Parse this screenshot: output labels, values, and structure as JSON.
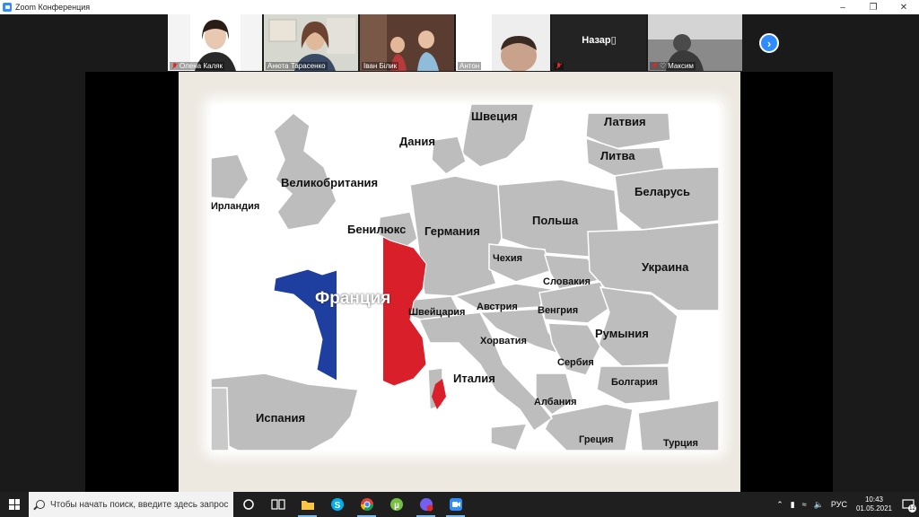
{
  "window": {
    "title": "Zoom Конференция"
  },
  "participants": [
    {
      "name": "Олена Каляк",
      "muted": true
    },
    {
      "name": "Анюта Тарасенко",
      "muted": false
    },
    {
      "name": "Іван Білик",
      "muted": false
    },
    {
      "name": "Антон",
      "muted": false
    },
    {
      "name": "Назар",
      "display_name": "Назар▯",
      "muted": true
    },
    {
      "name": "Максим",
      "muted": true
    }
  ],
  "slide": {
    "title_country": "Франция",
    "countries": [
      "Швеция",
      "Латвия",
      "Дания",
      "Литва",
      "Великобритания",
      "Беларусь",
      "Ирландия",
      "Бенилюкс",
      "Германия",
      "Польша",
      "Чехия",
      "Украина",
      "Словакия",
      "Швейцария",
      "Австрия",
      "Венгрия",
      "Хорватия",
      "Румыния",
      "Сербия",
      "Италия",
      "Болгария",
      "Албания",
      "Испания",
      "Греция",
      "Турция"
    ]
  },
  "taskbar": {
    "search_placeholder": "Чтобы начать поиск, введите здесь запрос",
    "language": "РУС",
    "time": "10:43",
    "date": "01.05.2021",
    "notifications": "12"
  },
  "colors": {
    "zoom_blue": "#2d8cff",
    "france_blue": "#1e3fa0",
    "france_red": "#d9202a",
    "land_gray": "#bdbdbd"
  }
}
